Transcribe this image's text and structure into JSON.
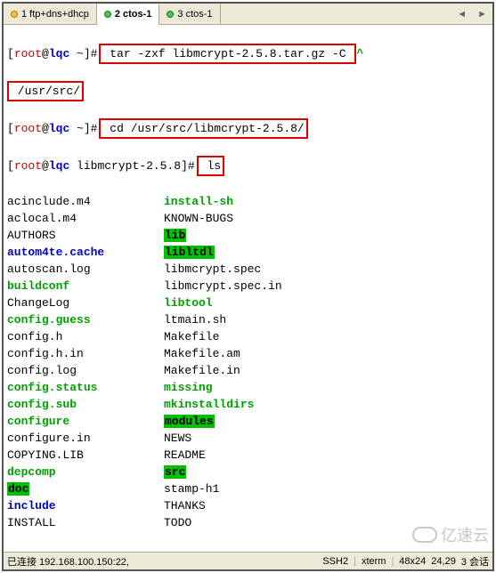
{
  "tabs": [
    {
      "label": "1 ftp+dns+dhcp",
      "active": false
    },
    {
      "label": "2 ctos-1",
      "active": true
    },
    {
      "label": "3 ctos-1",
      "active": false
    }
  ],
  "prompt1": {
    "user": "root",
    "at": "@",
    "host": "lqc",
    "path": " ~",
    "mark": "#"
  },
  "cmd1_a": " tar -zxf libmcrypt-2.5.8.tar.gz -C ",
  "cmd1_b": " /usr/src/",
  "prompt2": {
    "user": "root",
    "at": "@",
    "host": "lqc",
    "path": " ~",
    "mark": "#"
  },
  "cmd2": " cd /usr/src/libmcrypt-2.5.8/",
  "prompt3": {
    "user": "root",
    "at": "@",
    "host": "lqc",
    "path": " libmcrypt-2.5.8",
    "mark": "#"
  },
  "cmd3": " ls",
  "ls": [
    {
      "a": "acinclude.m4",
      "a_cls": "",
      "b": "install-sh",
      "b_cls": "green"
    },
    {
      "a": "aclocal.m4",
      "a_cls": "",
      "b": "KNOWN-BUGS",
      "b_cls": ""
    },
    {
      "a": "AUTHORS",
      "a_cls": "",
      "b": "lib",
      "b_cls": "green-bg"
    },
    {
      "a": "autom4te.cache",
      "a_cls": "blue-bold",
      "b": "libltdl",
      "b_cls": "green-bg"
    },
    {
      "a": "autoscan.log",
      "a_cls": "",
      "b": "libmcrypt.spec",
      "b_cls": ""
    },
    {
      "a": "buildconf",
      "a_cls": "green",
      "b": "libmcrypt.spec.in",
      "b_cls": ""
    },
    {
      "a": "ChangeLog",
      "a_cls": "",
      "b": "libtool",
      "b_cls": "green"
    },
    {
      "a": "config.guess",
      "a_cls": "green",
      "b": "ltmain.sh",
      "b_cls": ""
    },
    {
      "a": "config.h",
      "a_cls": "",
      "b": "Makefile",
      "b_cls": ""
    },
    {
      "a": "config.h.in",
      "a_cls": "",
      "b": "Makefile.am",
      "b_cls": ""
    },
    {
      "a": "config.log",
      "a_cls": "",
      "b": "Makefile.in",
      "b_cls": ""
    },
    {
      "a": "config.status",
      "a_cls": "green",
      "b": "missing",
      "b_cls": "green"
    },
    {
      "a": "config.sub",
      "a_cls": "green",
      "b": "mkinstalldirs",
      "b_cls": "green"
    },
    {
      "a": "configure",
      "a_cls": "green",
      "b": "modules",
      "b_cls": "green-bg"
    },
    {
      "a": "configure.in",
      "a_cls": "",
      "b": "NEWS",
      "b_cls": ""
    },
    {
      "a": "COPYING.LIB",
      "a_cls": "",
      "b": "README",
      "b_cls": ""
    },
    {
      "a": "depcomp",
      "a_cls": "green",
      "b": "src",
      "b_cls": "green-bg"
    },
    {
      "a": "doc",
      "a_cls": "green-bg",
      "b": "stamp-h1",
      "b_cls": ""
    },
    {
      "a": "include",
      "a_cls": "blue-bold",
      "b": "THANKS",
      "b_cls": ""
    },
    {
      "a": "INSTALL",
      "a_cls": "",
      "b": "TODO",
      "b_cls": ""
    }
  ],
  "status": {
    "conn": "已连接 192.168.100.150:22,",
    "proto": "SSH2",
    "term": "xterm",
    "size": "48x24",
    "pos": "24,29",
    "sessions": "3 会话"
  },
  "watermark": "亿速云"
}
